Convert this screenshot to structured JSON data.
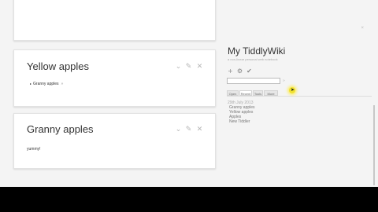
{
  "story": {
    "tiddlers": [
      {
        "title": "Yellow apples",
        "subtitle": "",
        "list": [
          {
            "label": "Granny apples",
            "tag_mark": "»"
          }
        ],
        "body": ""
      },
      {
        "title": "Granny apples",
        "subtitle": "",
        "list": [],
        "body": "yummy!"
      }
    ],
    "controls": {
      "collapse": "⌄",
      "edit": "✎",
      "close": "✕"
    }
  },
  "sidebar": {
    "close": "×",
    "site_title": "My TiddlyWiki",
    "site_subtitle": "a non-linear personal web notebook",
    "icons": {
      "new": "+",
      "control_panel": "⚙",
      "save": "✔"
    },
    "search": {
      "value": "",
      "button": "»"
    },
    "tabs": [
      {
        "label": "Open",
        "active": false
      },
      {
        "label": "Recent",
        "active": true
      },
      {
        "label": "Tools",
        "active": false
      },
      {
        "label": "More",
        "active": false
      }
    ],
    "recent": {
      "date": "29th July 2013",
      "items": [
        "Granny apples",
        "Yellow apples",
        "Apples",
        "New Tiddler"
      ]
    }
  }
}
